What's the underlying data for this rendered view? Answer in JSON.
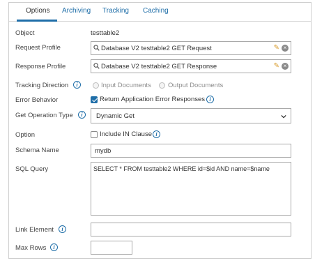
{
  "tabs": [
    {
      "label": "Options",
      "active": true
    },
    {
      "label": "Archiving",
      "active": false
    },
    {
      "label": "Tracking",
      "active": false
    },
    {
      "label": "Caching",
      "active": false
    }
  ],
  "object": {
    "label": "Object",
    "value": "testtable2"
  },
  "request_profile": {
    "label": "Request Profile",
    "value": "Database V2 testtable2 GET Request"
  },
  "response_profile": {
    "label": "Response Profile",
    "value": "Database V2 testtable2 GET Response"
  },
  "tracking_direction": {
    "label": "Tracking Direction",
    "options": [
      "Input Documents",
      "Output Documents"
    ]
  },
  "error_behavior": {
    "label": "Error Behavior",
    "checkbox_label": "Return Application Error Responses",
    "checked": true
  },
  "get_operation_type": {
    "label": "Get Operation Type",
    "value": "Dynamic Get"
  },
  "option": {
    "label": "Option",
    "checkbox_label": "Include IN Clause",
    "checked": false
  },
  "schema_name": {
    "label": "Schema Name",
    "value": "mydb"
  },
  "sql_query": {
    "label": "SQL Query",
    "value": "SELECT * FROM testtable2 WHERE id=$id AND name=$name"
  },
  "link_element": {
    "label": "Link Element",
    "value": ""
  },
  "max_rows": {
    "label": "Max Rows",
    "value": ""
  },
  "colors": {
    "accent": "#1f6ea8",
    "border": "#a9a9a9",
    "pencil": "#d89a2a"
  },
  "icons": {
    "info": "info-icon",
    "search": "search-icon",
    "edit": "pencil-icon",
    "clear": "clear-icon",
    "dropdown": "chevron-down-icon"
  }
}
